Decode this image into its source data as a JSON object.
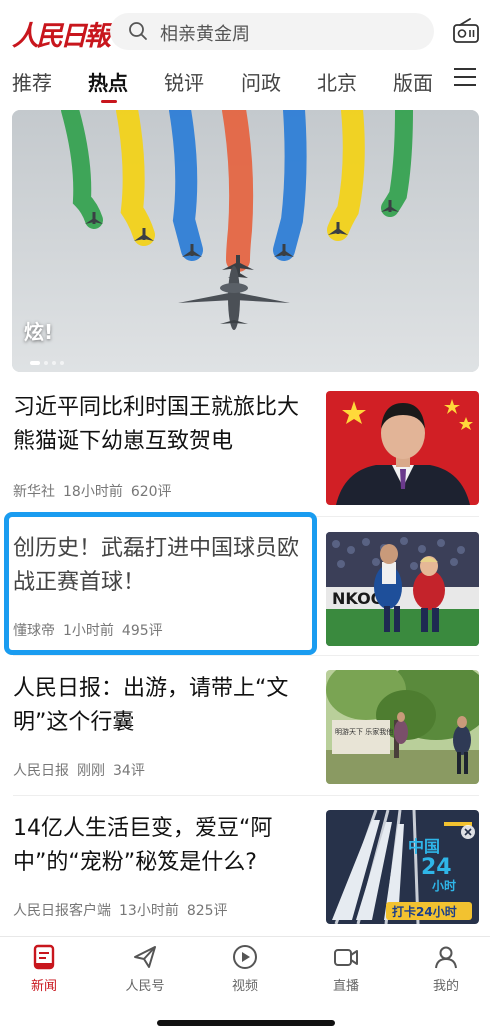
{
  "header": {
    "logo_text": "人民日報",
    "search_placeholder": "相亲黄金周"
  },
  "tabs": [
    "推荐",
    "热点",
    "锐评",
    "问政",
    "北京",
    "版面"
  ],
  "active_tab": "热点",
  "banner": {
    "caption": "炫!",
    "slide_count": 4,
    "active_slide": 1
  },
  "news": [
    {
      "title": "习近平同比利时国王就旅比大熊猫诞下幼崽互致贺电",
      "source": "新华社",
      "time": "18小时前",
      "comments": "620评"
    },
    {
      "title": "创历史！武磊打进中国球员欧战正赛首球！",
      "source": "懂球帝",
      "time": "1小时前",
      "comments": "495评"
    },
    {
      "title": "人民日报：出游，请带上“文明”这个行囊",
      "source": "人民日报",
      "time": "刚刚",
      "comments": "34评"
    },
    {
      "title": "14亿人生活巨变，爱豆“阿中”的“宠粉”秘笈是什么?",
      "source": "人民日报客户端",
      "time": "13小时前",
      "comments": "825评"
    }
  ],
  "thumb4_text": {
    "line1": "中国",
    "line2": "24",
    "line3": "小时",
    "badge": "打卡24小时"
  },
  "thumb3_sign": "明游天下 乐家我他",
  "thumb2_sign": "NKOON",
  "bottom_nav": [
    "新闻",
    "人民号",
    "视频",
    "直播",
    "我的"
  ],
  "active_nav": "新闻",
  "colors": {
    "brand_red": "#c8161d",
    "highlight_blue": "#1a9cf0"
  }
}
